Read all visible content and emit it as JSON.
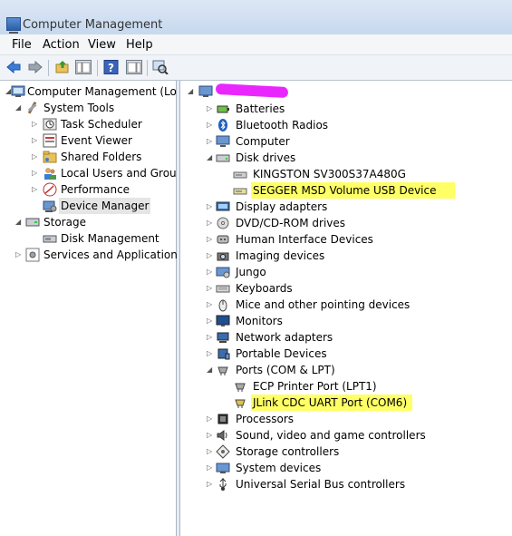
{
  "window": {
    "title": "Computer Management"
  },
  "menu": {
    "file": "File",
    "action": "Action",
    "view": "View",
    "help": "Help"
  },
  "left_tree": {
    "root": "Computer Management (Local",
    "system_tools": "System Tools",
    "task_scheduler": "Task Scheduler",
    "event_viewer": "Event Viewer",
    "shared_folders": "Shared Folders",
    "local_users": "Local Users and Groups",
    "performance": "Performance",
    "device_manager": "Device Manager",
    "storage": "Storage",
    "disk_management": "Disk Management",
    "services": "Services and Applications"
  },
  "right_tree": {
    "batteries": "Batteries",
    "bluetooth": "Bluetooth Radios",
    "computer": "Computer",
    "disk_drives": "Disk drives",
    "kingston": "KINGSTON SV300S37A480G",
    "segger": "SEGGER MSD Volume USB Device",
    "display": "Display adapters",
    "dvd": "DVD/CD-ROM drives",
    "hid": "Human Interface Devices",
    "imaging": "Imaging devices",
    "jungo": "Jungo",
    "keyboards": "Keyboards",
    "mice": "Mice and other pointing devices",
    "monitors": "Monitors",
    "network": "Network adapters",
    "portable": "Portable Devices",
    "ports": "Ports (COM & LPT)",
    "ecp": "ECP Printer Port (LPT1)",
    "jlink": "JLink CDC UART Port (COM6)",
    "processors": "Processors",
    "sound": "Sound, video and game controllers",
    "storage_ctrl": "Storage controllers",
    "system_devices": "System devices",
    "usb": "Universal Serial Bus controllers"
  },
  "colors": {
    "highlight": "#ffff66",
    "redaction": "#e600ff",
    "selection": "#e5e5e5"
  }
}
